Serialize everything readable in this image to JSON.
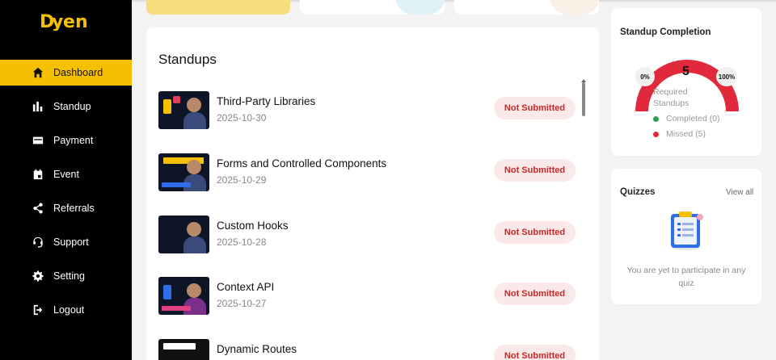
{
  "brand": {
    "logo_text": "DYEN",
    "accent": "#f5c000"
  },
  "sidebar": {
    "items": [
      {
        "label": "Dashboard",
        "icon": "home-icon",
        "active": true
      },
      {
        "label": "Standup",
        "icon": "bar-chart-icon"
      },
      {
        "label": "Payment",
        "icon": "card-icon"
      },
      {
        "label": "Event",
        "icon": "calendar-icon"
      },
      {
        "label": "Referrals",
        "icon": "share-icon"
      },
      {
        "label": "Support",
        "icon": "headset-icon"
      },
      {
        "label": "Setting",
        "icon": "gear-icon"
      },
      {
        "label": "Logout",
        "icon": "logout-icon"
      }
    ]
  },
  "standups": {
    "title": "Standups",
    "rows": [
      {
        "title": "Third-Party Libraries",
        "date": "2025-10-30",
        "status": "Not Submitted"
      },
      {
        "title": "Forms and Controlled Components",
        "date": "2025-10-29",
        "status": "Not Submitted"
      },
      {
        "title": "Custom Hooks",
        "date": "2025-10-28",
        "status": "Not Submitted"
      },
      {
        "title": "Context API",
        "date": "2025-10-27",
        "status": "Not Submitted"
      },
      {
        "title": "Dynamic Routes",
        "date": "",
        "status": "Not Submitted"
      }
    ],
    "status_color": "#c62828"
  },
  "completion": {
    "title": "Standup Completion",
    "min_label": "0%",
    "max_label": "100%",
    "required_count": "5",
    "required_label": "Required Standups",
    "legend": [
      {
        "label": "Completed (0)",
        "color": "#2e9e4f"
      },
      {
        "label": "Missed (5)",
        "color": "#e2283b"
      }
    ],
    "gauge_color": "#e2283b"
  },
  "quizzes": {
    "title": "Quizzes",
    "view_all": "View all",
    "empty_text": "You are yet to participate in any quiz"
  }
}
